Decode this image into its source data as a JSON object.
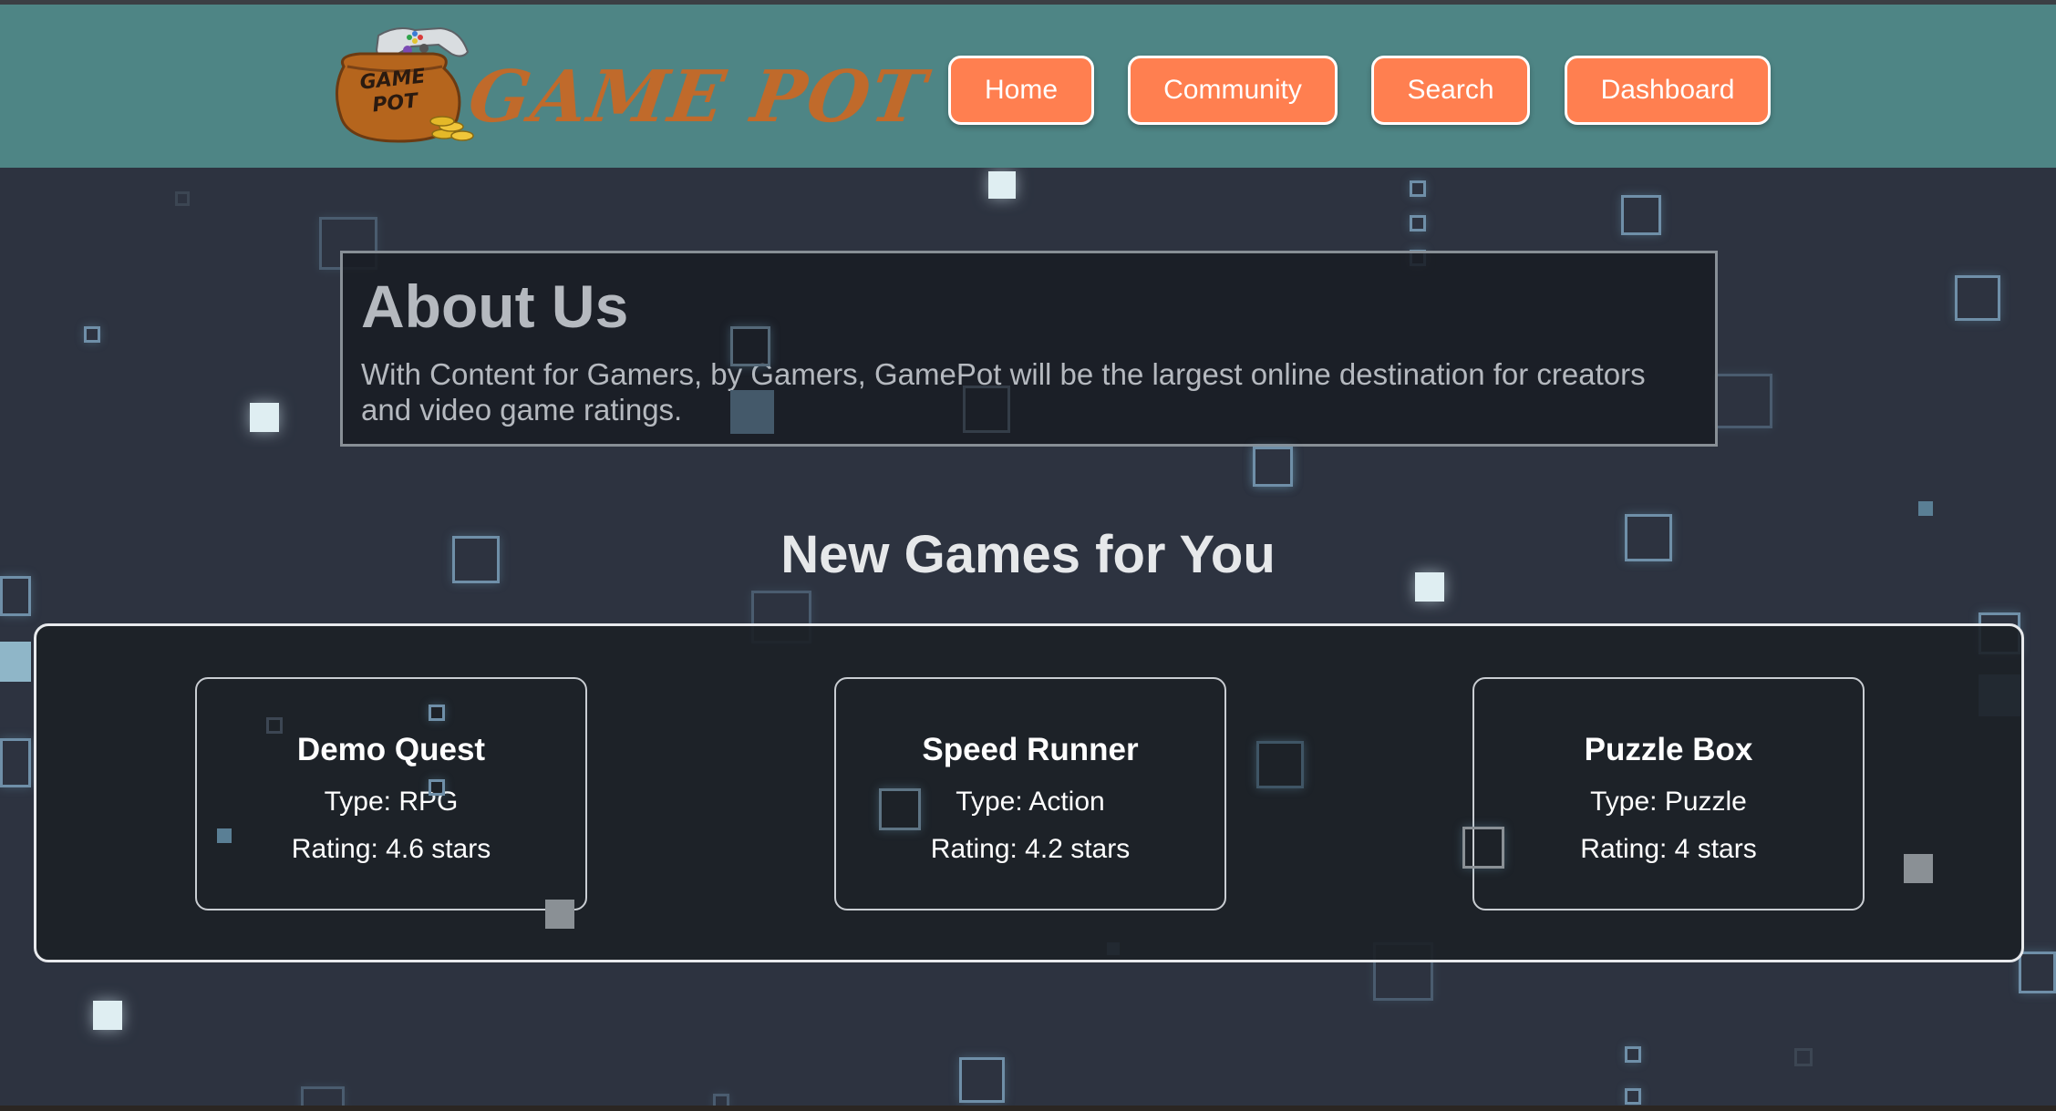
{
  "header": {
    "logo_text": "GAME POT",
    "logo_pot_label": "GAME POT",
    "nav": [
      {
        "label": "Home"
      },
      {
        "label": "Community"
      },
      {
        "label": "Search"
      },
      {
        "label": "Dashboard"
      }
    ]
  },
  "about": {
    "title": "About Us",
    "text": "With Content for Gamers, by Gamers, GamePot will be the largest online destination for creators and video game ratings."
  },
  "games_section": {
    "title": "New Games for You",
    "games": [
      {
        "name": "Demo Quest",
        "type": "Type: RPG",
        "rating": "Rating: 4.6 stars"
      },
      {
        "name": "Speed Runner",
        "type": "Type: Action",
        "rating": "Rating: 4.2 stars"
      },
      {
        "name": "Puzzle Box",
        "type": "Type: Puzzle",
        "rating": "Rating: 4 stars"
      }
    ]
  },
  "colors": {
    "header_bg": "#4e8585",
    "nav_button": "#ff7f50",
    "page_bg": "#2d3340",
    "logo_text": "#c06a2b"
  },
  "icons": [
    "game-controller-icon",
    "clay-pot-icon",
    "gold-coins-icon"
  ]
}
